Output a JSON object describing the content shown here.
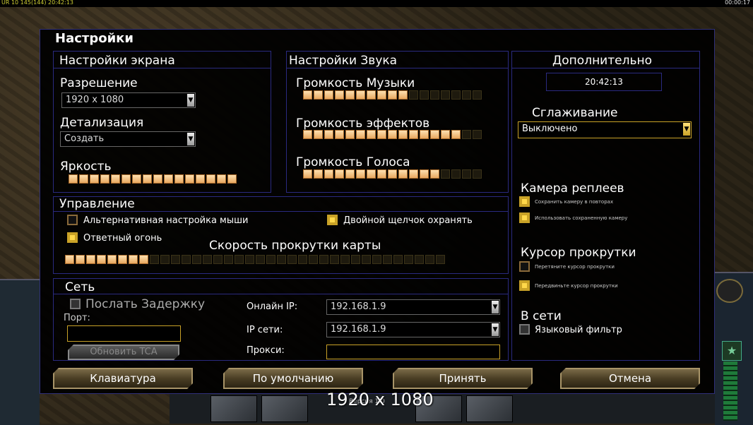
{
  "hud": {
    "left_text": "UR 10 145(144) 20:42:13",
    "right_text": "00:00:17"
  },
  "window_title": "Настройки",
  "screen": {
    "title": "Настройки экрана",
    "resolution_label": "Разрешение",
    "resolution_value": "1920 x 1080",
    "detail_label": "Детализация",
    "detail_value": "Создать",
    "brightness_label": "Яркость",
    "brightness_level": "16/16"
  },
  "sound": {
    "title": "Настройки Звука",
    "music_label": "Громкость Музыки",
    "music_level": "10/17",
    "effects_label": "Громкость эффектов",
    "effects_level": "15/17",
    "voice_label": "Громкость Голоса",
    "voice_level": "13/17"
  },
  "extra": {
    "title": "Дополнительно",
    "time": "20:42:13",
    "antialias_label": "Сглаживание",
    "antialias_value": "Выключено",
    "replay_camera_title": "Камера реплеев",
    "save_camera_label": "Сохранить камеру в повторах",
    "use_saved_camera_label": "Использовать сохраненную камеру",
    "scroll_cursor_title": "Курсор прокрутки",
    "drag_cursor_label": "Перетяните курсор прокрутки",
    "move_cursor_label": "Передвиньте курсор прокрутки",
    "online_title": "В сети",
    "language_filter_label": "Языковый фильтр"
  },
  "controls": {
    "title": "Управление",
    "alt_mouse_label": "Альтернативная настройка мыши",
    "double_click_label": "Двойной щелчок охранять",
    "return_fire_label": "Ответный огонь",
    "scroll_speed_label": "Скорость прокрутки карты",
    "scroll_speed_level": "8/36"
  },
  "network": {
    "title": "Сеть",
    "send_delay_label": "Послать Задержку",
    "port_label": "Порт:",
    "update_tca_label": "Обновить TCA",
    "online_ip_label": "Онлайн IP:",
    "online_ip_value": "192.168.1.9",
    "lan_ip_label": "IP сети:",
    "lan_ip_value": "192.168.1.9",
    "proxy_label": "Прокси:"
  },
  "buttons": {
    "keyboard": "Клавиатура",
    "defaults": "По умолчанию",
    "accept": "Принять",
    "cancel": "Отмена"
  },
  "overlay": {
    "resolution_text": "1920 x 1080",
    "version_text": "Версия 1.0"
  },
  "colors": {
    "accent_gold": "#c9a227",
    "border_blue": "#2a2a80",
    "slider_on": "#f0b878"
  }
}
